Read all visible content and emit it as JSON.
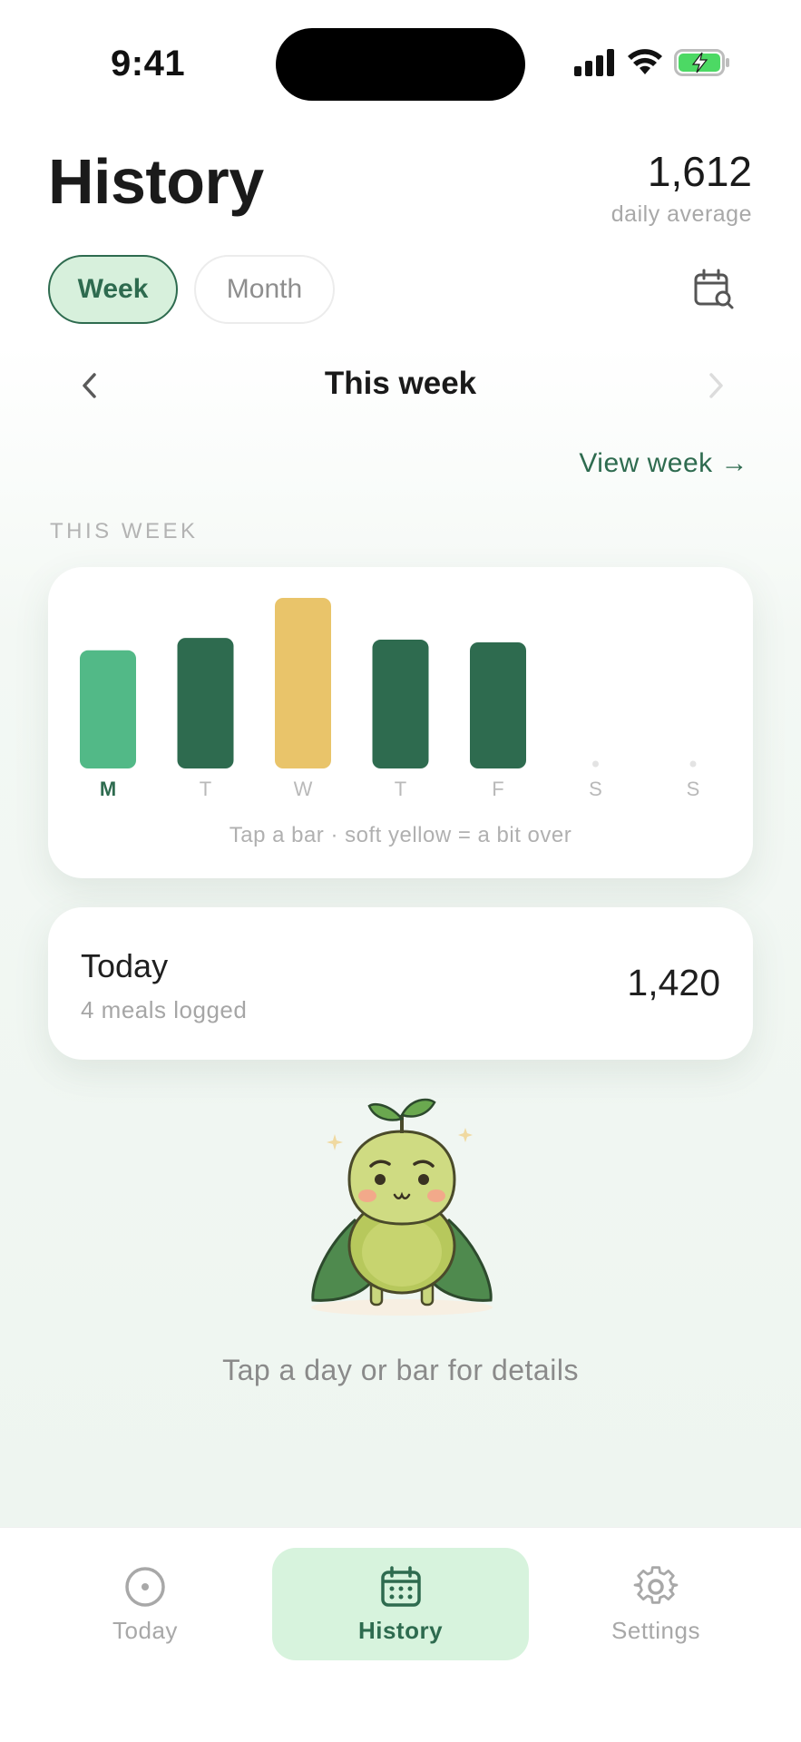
{
  "status_bar": {
    "time": "9:41"
  },
  "header": {
    "title": "History",
    "average_value": "1,612",
    "average_label": "daily average"
  },
  "segments": {
    "week_label": "Week",
    "month_label": "Month",
    "selected": "Week"
  },
  "week_nav": {
    "title": "This week"
  },
  "view_week_link": "View week →",
  "section_label": "THIS WEEK",
  "chart_data": {
    "type": "bar",
    "categories": [
      "M",
      "T",
      "W",
      "T",
      "F",
      "S",
      "S"
    ],
    "values": [
      1330,
      1470,
      1920,
      1450,
      1420,
      null,
      null
    ],
    "selected_index": 0,
    "bar_states": [
      "selected",
      "normal",
      "over",
      "normal",
      "normal",
      "empty",
      "empty"
    ],
    "colors": {
      "selected": "#52b987",
      "normal": "#2e6b4f",
      "over": "#e9c46a",
      "empty": "#e3e3e3"
    },
    "hint": "Tap a bar · soft yellow = a bit over",
    "ylim": [
      0,
      1920
    ]
  },
  "today_card": {
    "title": "Today",
    "subtitle": "4 meals logged",
    "value": "1,420"
  },
  "empty_hint": "Tap a day or bar for details",
  "bottom_nav": {
    "items": [
      {
        "label": "Today",
        "icon": "circle-dot-icon",
        "active": false
      },
      {
        "label": "History",
        "icon": "calendar-icon",
        "active": true
      },
      {
        "label": "Settings",
        "icon": "gear-icon",
        "active": false
      }
    ]
  },
  "colors": {
    "accent": "#2e6b4f",
    "accent_light": "#d7f0dc"
  }
}
